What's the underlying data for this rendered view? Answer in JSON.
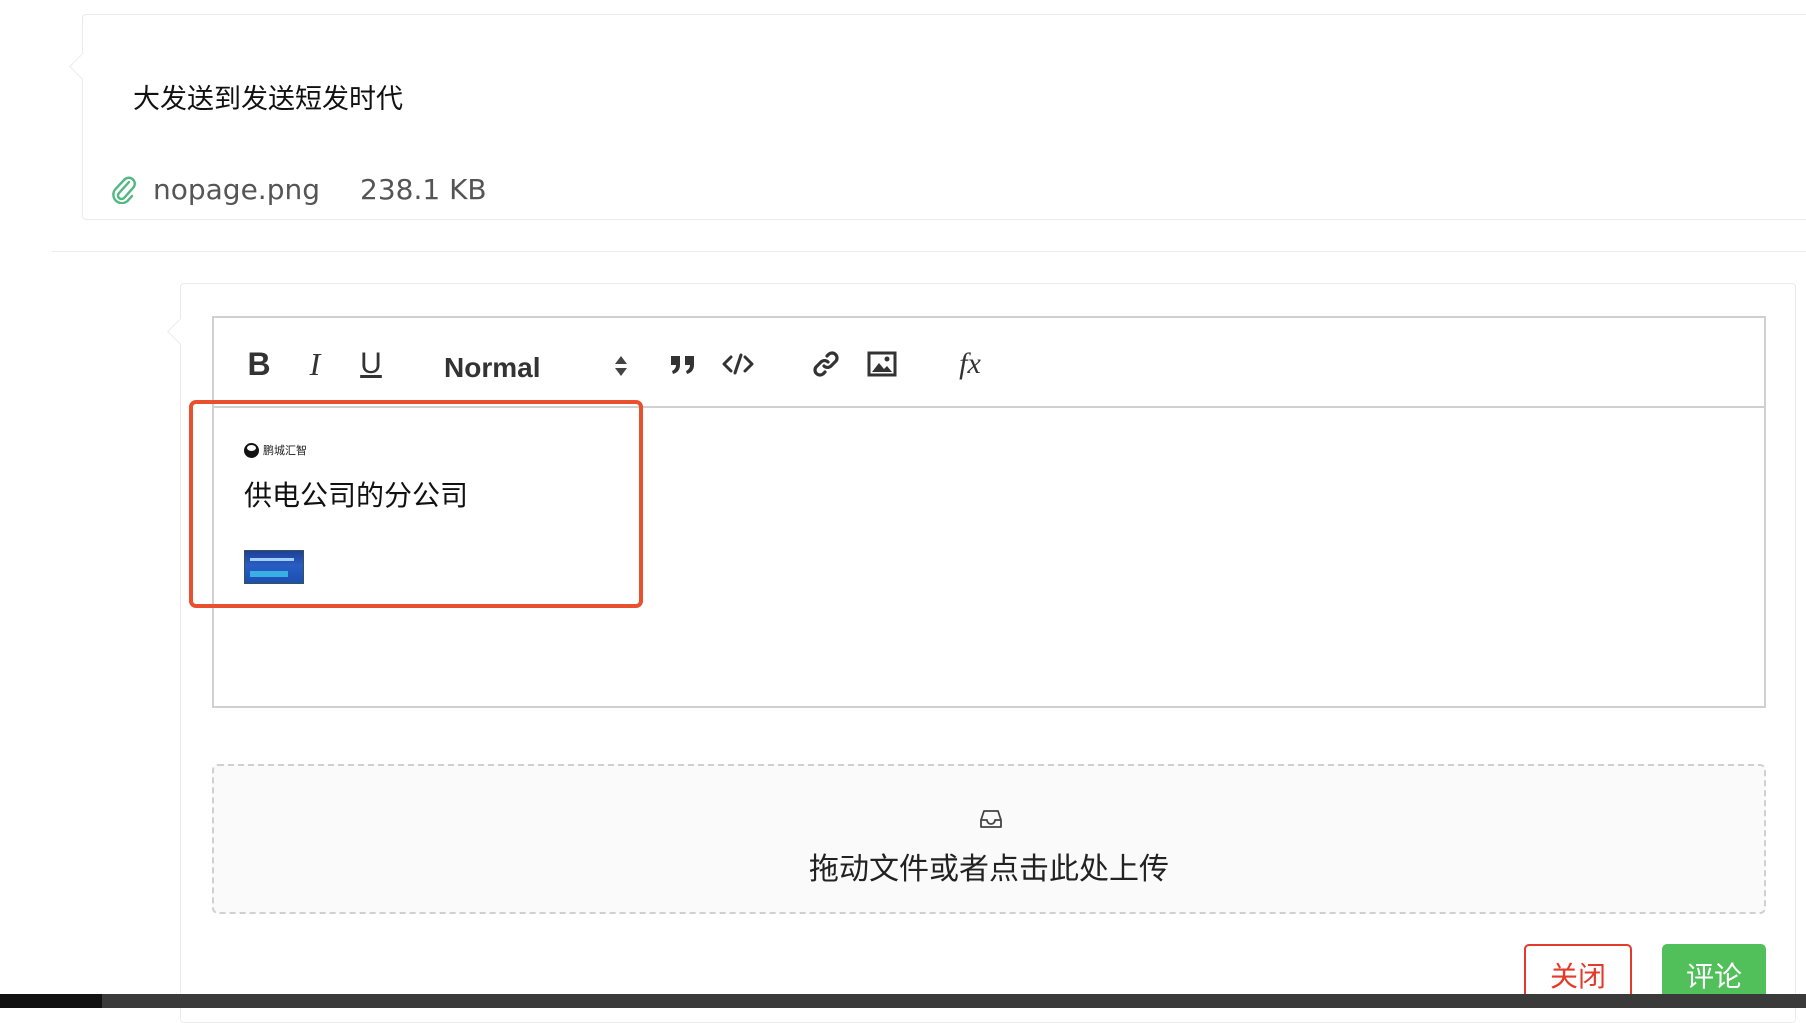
{
  "comment": {
    "text": "大发送到发送短发时代",
    "attachment": {
      "icon": "paperclip-icon",
      "file_name": "nopage.png",
      "file_size": "238.1 KB"
    }
  },
  "editor": {
    "toolbar": {
      "bold_label": "B",
      "italic_label": "I",
      "underline_label": "U",
      "format_select": "Normal",
      "formula_label": "fx"
    },
    "content": {
      "logo_text": "鹏城汇智",
      "line": "供电公司的分公司"
    }
  },
  "upload": {
    "icon": "inbox-icon",
    "text": "拖动文件或者点击此处上传"
  },
  "actions": {
    "close_label": "关闭",
    "comment_label": "评论"
  },
  "colors": {
    "highlight": "#e8502f",
    "danger": "#e33a2b",
    "success": "#52c05a",
    "attachment_icon": "#52b882"
  }
}
